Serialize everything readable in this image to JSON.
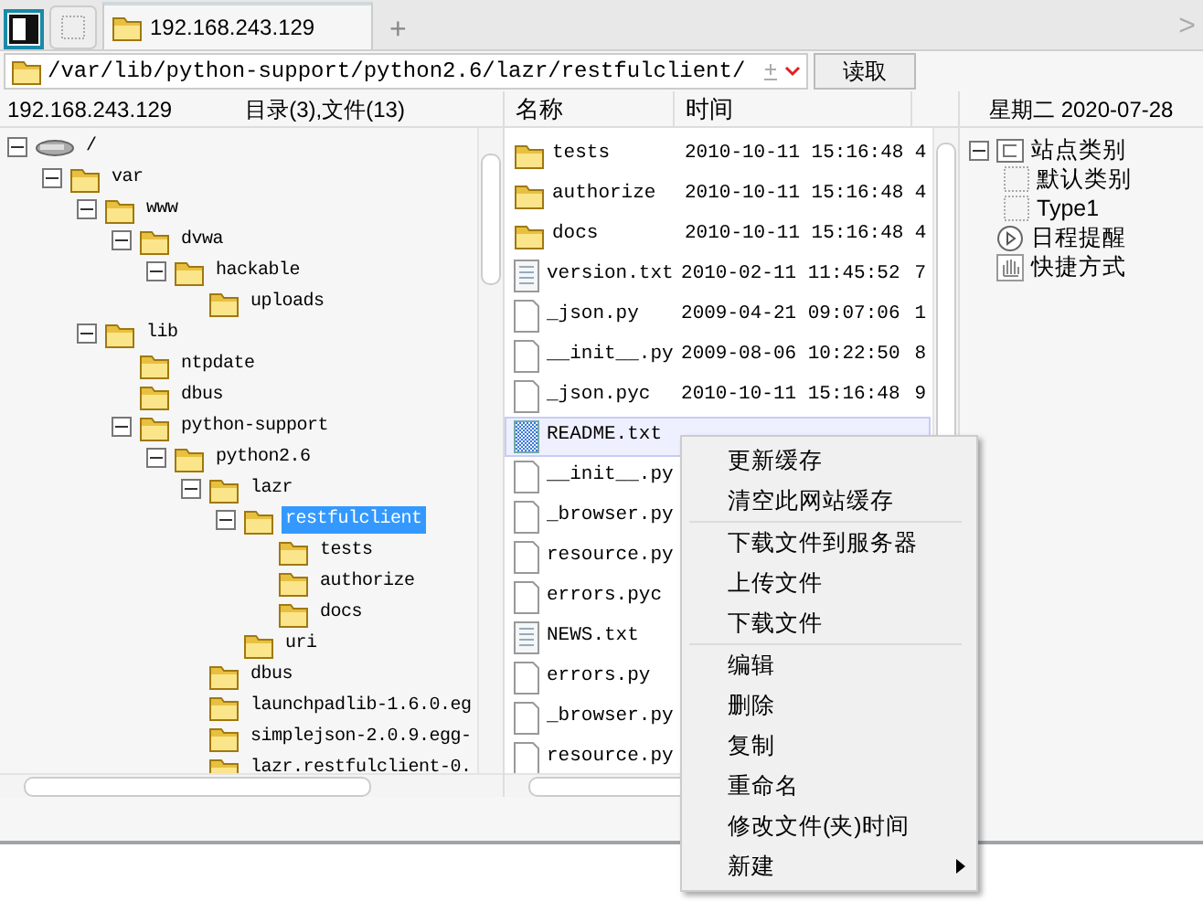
{
  "tab_bar": {
    "tabs": [
      {
        "label": "192.168.243.129",
        "selected": true
      }
    ],
    "add_symbol": "+",
    "scroll_symbol": ">"
  },
  "address_bar": {
    "path": "/var/lib/python-support/python2.6/lazr/restfulclient/",
    "read_button": "读取"
  },
  "tree_panel": {
    "host": "192.168.243.129",
    "summary": "目录(3),文件(13)",
    "root": {
      "label": "/",
      "kind": "drive",
      "expanded": true,
      "selected": false,
      "children": [
        {
          "label": "var",
          "kind": "folder",
          "expanded": true,
          "selected": false,
          "children": [
            {
              "label": "www",
              "kind": "folder",
              "expanded": true,
              "selected": false,
              "children": [
                {
                  "label": "dvwa",
                  "kind": "folder",
                  "expanded": true,
                  "selected": false,
                  "children": [
                    {
                      "label": "hackable",
                      "kind": "folder",
                      "expanded": true,
                      "selected": false,
                      "children": [
                        {
                          "label": "uploads",
                          "kind": "folder",
                          "selected": false
                        }
                      ]
                    }
                  ]
                }
              ]
            },
            {
              "label": "lib",
              "kind": "folder",
              "expanded": true,
              "selected": false,
              "children": [
                {
                  "label": "ntpdate",
                  "kind": "folder",
                  "selected": false
                },
                {
                  "label": "dbus",
                  "kind": "folder",
                  "selected": false
                },
                {
                  "label": "python-support",
                  "kind": "folder",
                  "expanded": true,
                  "selected": false,
                  "children": [
                    {
                      "label": "python2.6",
                      "kind": "folder",
                      "expanded": true,
                      "selected": false,
                      "children": [
                        {
                          "label": "lazr",
                          "kind": "folder",
                          "expanded": true,
                          "selected": false,
                          "children": [
                            {
                              "label": "restfulclient",
                              "kind": "folder",
                              "expanded": true,
                              "selected": true,
                              "children": [
                                {
                                  "label": "tests",
                                  "kind": "folder",
                                  "selected": false
                                },
                                {
                                  "label": "authorize",
                                  "kind": "folder",
                                  "selected": false
                                },
                                {
                                  "label": "docs",
                                  "kind": "folder",
                                  "selected": false
                                }
                              ]
                            },
                            {
                              "label": "uri",
                              "kind": "folder",
                              "selected": false
                            }
                          ]
                        },
                        {
                          "label": "dbus",
                          "kind": "folder",
                          "selected": false
                        },
                        {
                          "label": "launchpadlib-1.6.0.eg",
                          "kind": "folder",
                          "selected": false
                        },
                        {
                          "label": "simplejson-2.0.9.egg-",
                          "kind": "folder",
                          "selected": false
                        },
                        {
                          "label": "lazr.restfulclient-0.",
                          "kind": "folder",
                          "selected": false
                        }
                      ]
                    }
                  ]
                }
              ]
            }
          ]
        }
      ]
    }
  },
  "file_list": {
    "columns": [
      "名称",
      "时间"
    ],
    "rows": [
      {
        "name": "tests",
        "kind": "folder",
        "time": "2010-10-11 15:16:48",
        "column_3": "4",
        "selected": false
      },
      {
        "name": "authorize",
        "kind": "folder",
        "time": "2010-10-11 15:16:48",
        "column_3": "4",
        "selected": false
      },
      {
        "name": "docs",
        "kind": "folder",
        "time": "2010-10-11 15:16:48",
        "column_3": "4",
        "selected": false
      },
      {
        "name": "version.txt",
        "kind": "text",
        "time": "2010-02-11 11:45:52",
        "column_3": "7",
        "selected": false
      },
      {
        "name": "_json.py",
        "kind": "file",
        "time": "2009-04-21 09:07:06",
        "column_3": "1",
        "selected": false
      },
      {
        "name": "__init__.py",
        "kind": "file",
        "time": "2009-08-06 10:22:50",
        "column_3": "8",
        "selected": false
      },
      {
        "name": "_json.pyc",
        "kind": "file",
        "time": "2010-10-11 15:16:48",
        "column_3": "9",
        "selected": false
      },
      {
        "name": "README.txt",
        "kind": "pattern",
        "selected": true
      },
      {
        "name": "__init__.py",
        "kind": "file",
        "selected": false
      },
      {
        "name": "_browser.py",
        "kind": "file",
        "selected": false
      },
      {
        "name": "resource.py",
        "kind": "file",
        "selected": false
      },
      {
        "name": "errors.pyc",
        "kind": "file",
        "selected": false
      },
      {
        "name": "NEWS.txt",
        "kind": "text",
        "selected": false
      },
      {
        "name": "errors.py",
        "kind": "file",
        "selected": false
      },
      {
        "name": "_browser.py",
        "kind": "file",
        "selected": false
      },
      {
        "name": "resource.py",
        "kind": "file",
        "selected": false
      }
    ]
  },
  "side_panel": {
    "date": "星期二 2020-07-28",
    "items": [
      {
        "label": "站点类别",
        "kind": "category",
        "expanded": true,
        "children": [
          {
            "label": "默认类别",
            "kind": "dotted"
          },
          {
            "label": "Type1",
            "kind": "dotted"
          }
        ]
      },
      {
        "label": "日程提醒",
        "kind": "schedule"
      },
      {
        "label": "快捷方式",
        "kind": "hand"
      }
    ]
  },
  "context_menu": [
    {
      "kind": "item",
      "label": "更新缓存",
      "submenu": false
    },
    {
      "kind": "item",
      "label": "清空此网站缓存",
      "submenu": false
    },
    {
      "kind": "separator"
    },
    {
      "kind": "item",
      "label": "下载文件到服务器",
      "submenu": false
    },
    {
      "kind": "item",
      "label": "上传文件",
      "submenu": false
    },
    {
      "kind": "item",
      "label": "下载文件",
      "submenu": false
    },
    {
      "kind": "separator"
    },
    {
      "kind": "item",
      "label": "编辑",
      "submenu": false
    },
    {
      "kind": "item",
      "label": "删除",
      "submenu": false
    },
    {
      "kind": "item",
      "label": "复制",
      "submenu": false
    },
    {
      "kind": "item",
      "label": "重命名",
      "submenu": false
    },
    {
      "kind": "item",
      "label": "修改文件(夹)时间",
      "submenu": false
    },
    {
      "kind": "item",
      "label": "新建",
      "submenu": true
    }
  ]
}
